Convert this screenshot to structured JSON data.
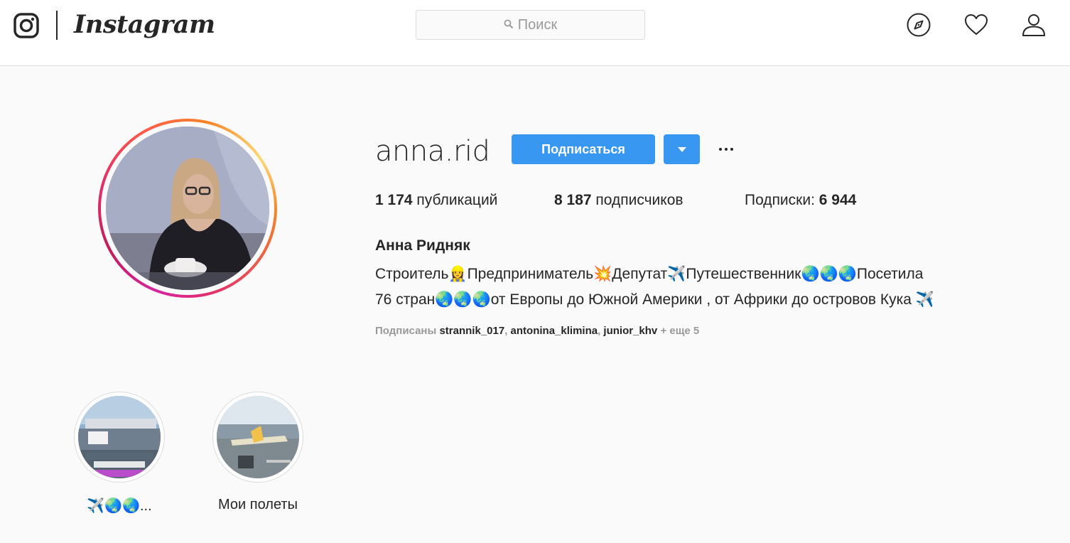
{
  "header": {
    "brand": "Instagram",
    "search_placeholder": "Поиск",
    "icons": [
      "instagram-glyph-icon",
      "search-icon",
      "compass-icon",
      "heart-icon",
      "user-icon"
    ]
  },
  "profile": {
    "username": "anna.rid",
    "follow_label": "Подписаться",
    "posts_count": "1 174",
    "posts_label": "публикаций",
    "followers_count": "8 187",
    "followers_label": "подписчиков",
    "following_label": "Подписки:",
    "following_count": "6 944",
    "full_name": "Анна Ридняк",
    "bio_line1": "Строитель👷‍♀️Предприниматель💥Депутат✈️Путешественник🌏🌏🌏Посетила",
    "bio_line2": "76 стран🌏🌏🌏от Европы до Южной Америки , от Африки до островов Кука ✈️",
    "followed_by_label": "Подписаны",
    "followed_by_users": [
      "strannik_017",
      "antonina_klimina",
      "junior_khv"
    ],
    "followed_by_more": "+ еще 5"
  },
  "highlights": [
    {
      "label": "✈️🌏🌏..."
    },
    {
      "label": "Мои полеты"
    }
  ],
  "colors": {
    "accent": "#3897f0",
    "text": "#262626",
    "muted": "#999999",
    "border": "#dbdbdb",
    "background": "#fafafa"
  }
}
